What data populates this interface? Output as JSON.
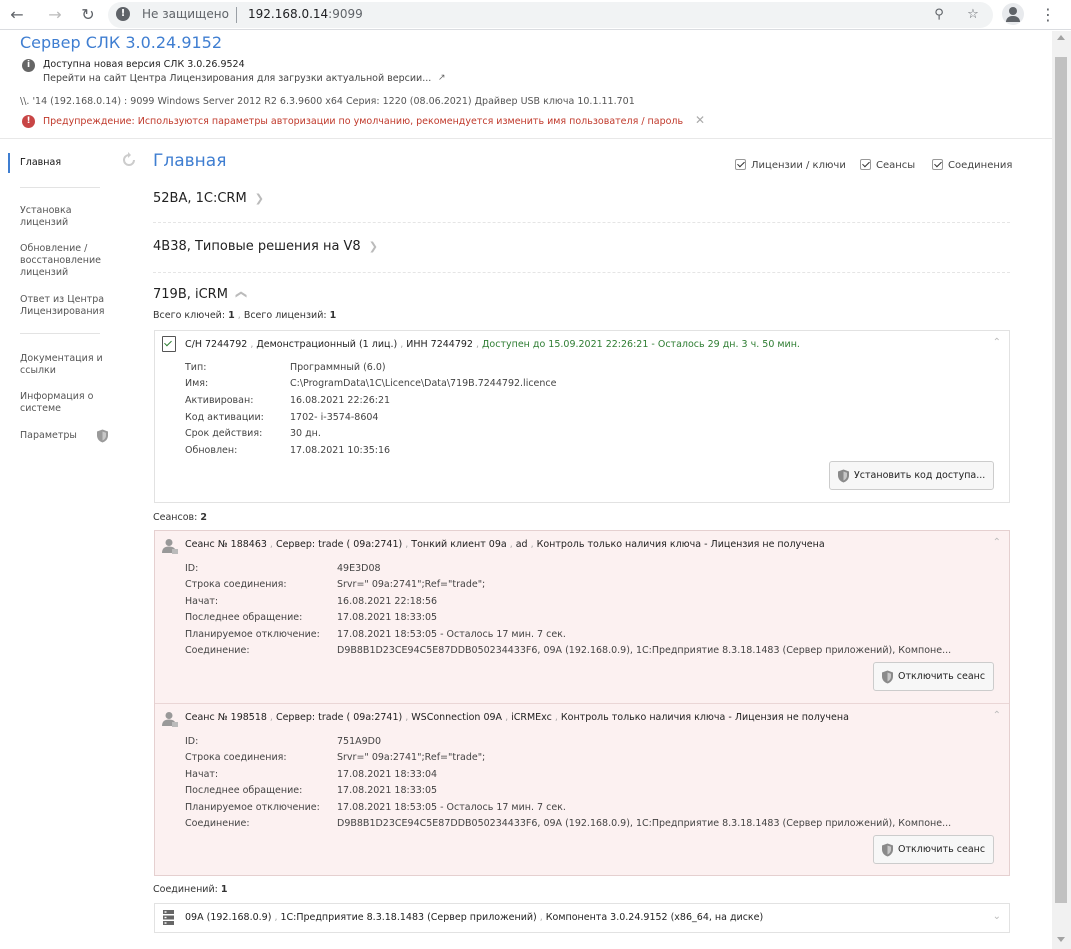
{
  "browser": {
    "security_label": "Не защищено",
    "url_host": "192.168.0.14",
    "url_port": ":9099",
    "back_icon": "arrow-left-icon",
    "forward_icon": "arrow-right-icon",
    "reload_icon": "reload-icon"
  },
  "header": {
    "title": "Сервер СЛК 3.0.24.9152",
    "update_text": "Доступна новая версия СЛК 3.0.26.9524",
    "update_link": "Перейти на сайт Центра Лицензирования для загрузки актуальной версии...",
    "system_line": "\\\\.      '14 (192.168.0.14) : 9099   Windows Server 2012 R2 6.3.9600 x64   Серия: 1220 (08.06.2021)   Драйвер USB ключа 10.1.11.701",
    "warning": "Предупреждение: Используются параметры авторизации по умолчанию, рекомендуется изменить имя пользователя / пароль"
  },
  "sidebar": {
    "items": [
      {
        "label": "Главная"
      },
      {
        "label": "Установка лицензий"
      },
      {
        "label": "Обновление / восстановление лицензий"
      },
      {
        "label": "Ответ из Центра Лицензирования"
      },
      {
        "label": "Документация и ссылки"
      },
      {
        "label": "Информация о системе"
      },
      {
        "label": "Параметры"
      }
    ]
  },
  "main": {
    "title": "Главная",
    "filters": [
      {
        "label": "Лицензии / ключи",
        "checked": true
      },
      {
        "label": "Сеансы",
        "checked": true
      },
      {
        "label": "Соединения",
        "checked": true
      }
    ],
    "groups": [
      {
        "title": "52BA, 1C:CRM"
      },
      {
        "title": "4B38, Типовые решения на V8"
      },
      {
        "title": "719B, iCRM"
      }
    ],
    "totals": {
      "keys_label": "Всего ключей:",
      "keys": "1",
      "lic_label": "Всего лицензий:",
      "lic": "1"
    }
  },
  "license": {
    "serial": "С/Н 7244792",
    "kind": "Демонстрационный (1 лиц.)",
    "inn": "ИНН 7244792",
    "status": "Доступен до 15.09.2021 22:26:21 - Осталось 29 дн. 3 ч. 50 мин.",
    "fields": [
      {
        "k": "Тип:",
        "v": "Программный (6.0)"
      },
      {
        "k": "Имя:",
        "v": "C:\\ProgramData\\1C\\Licence\\Data\\719B.7244792.licence"
      },
      {
        "k": "Активирован:",
        "v": "16.08.2021 22:26:21"
      },
      {
        "k": "Код активации:",
        "v": "1702-                i-3574-8604"
      },
      {
        "k": "Срок действия:",
        "v": "30 дн."
      },
      {
        "k": "Обновлен:",
        "v": "17.08.2021 10:35:16"
      }
    ],
    "button": "Установить код доступа..."
  },
  "sessions": {
    "label": "Сеансов:",
    "count": "2",
    "items": [
      {
        "head": [
          "Сеанс № 188463",
          "Сервер: trade (      09a:2741)",
          "Тонкий клиент        09a",
          "ad",
          "Контроль только наличия ключа - Лицензия не получена"
        ],
        "fields": [
          {
            "k": "ID:",
            "v": "49E3D08"
          },
          {
            "k": "Строка соединения:",
            "v": "Srvr=\"      09a:2741\";Ref=\"trade\";"
          },
          {
            "k": "Начат:",
            "v": "16.08.2021 22:18:56"
          },
          {
            "k": "Последнее обращение:",
            "v": "17.08.2021 18:33:05"
          },
          {
            "k": "Планируемое отключение:",
            "v": "17.08.2021 18:53:05 - Осталось 17 мин. 7 сек."
          },
          {
            "k": "Соединение:",
            "v": "D9B8B1D23CE94C5E87DDB050234433F6,           09A (192.168.0.9), 1С:Предприятие 8.3.18.1483 (Сервер приложений), Компоне..."
          }
        ],
        "button": "Отключить сеанс"
      },
      {
        "head": [
          "Сеанс № 198518",
          "Сервер: trade (      09a:2741)",
          "WSConnection          09A",
          "iCRMExc",
          "Контроль только наличия ключа - Лицензия не получена"
        ],
        "fields": [
          {
            "k": "ID:",
            "v": "751A9D0"
          },
          {
            "k": "Строка соединения:",
            "v": "Srvr=\"      09a:2741\";Ref=\"trade\";"
          },
          {
            "k": "Начат:",
            "v": "17.08.2021 18:33:04"
          },
          {
            "k": "Последнее обращение:",
            "v": "17.08.2021 18:33:05"
          },
          {
            "k": "Планируемое отключение:",
            "v": "17.08.2021 18:53:05 - Осталось 17 мин. 7 сек."
          },
          {
            "k": "Соединение:",
            "v": "D9B8B1D23CE94C5E87DDB050234433F6,          09A (192.168.0.9), 1С:Предприятие 8.3.18.1483 (Сервер приложений), Компоне..."
          }
        ],
        "button": "Отключить сеанс"
      }
    ]
  },
  "connections": {
    "label": "Соединений:",
    "count": "1",
    "items": [
      {
        "parts": [
          "       09A (192.168.0.9)",
          "1С:Предприятие 8.3.18.1483 (Сервер приложений)",
          "Компонента 3.0.24.9152 (x86_64, на диске)"
        ]
      }
    ]
  },
  "colors": {
    "accent": "#3f7ed1",
    "warning": "#c0392b",
    "ok": "#2e7d32",
    "session_bg": "#fcf1f1"
  }
}
